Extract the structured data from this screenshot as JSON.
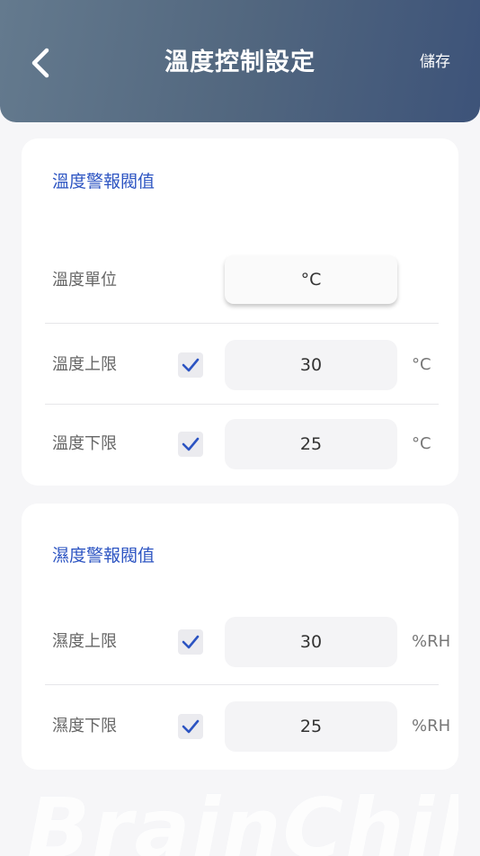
{
  "header": {
    "title": "溫度控制設定",
    "save_label": "儲存",
    "back_icon": "chevron-left-icon"
  },
  "temperature_section": {
    "title": "溫度警報閥值",
    "unit_label": "溫度單位",
    "unit_value": "°C",
    "upper": {
      "label": "溫度上限",
      "checked": true,
      "value": "30",
      "unit": "°C"
    },
    "lower": {
      "label": "溫度下限",
      "checked": true,
      "value": "25",
      "unit": "°C"
    }
  },
  "humidity_section": {
    "title": "濕度警報閥值",
    "upper": {
      "label": "濕度上限",
      "checked": true,
      "value": "30",
      "unit": "%RH"
    },
    "lower": {
      "label": "濕度下限",
      "checked": true,
      "value": "25",
      "unit": "%RH"
    }
  },
  "watermark": "BrainChild",
  "colors": {
    "header_gradient_start": "#647a8e",
    "header_gradient_end": "#3d5379",
    "accent": "#2c54c2",
    "check_mark": "#2c54c2",
    "background": "#f6f6f8"
  }
}
